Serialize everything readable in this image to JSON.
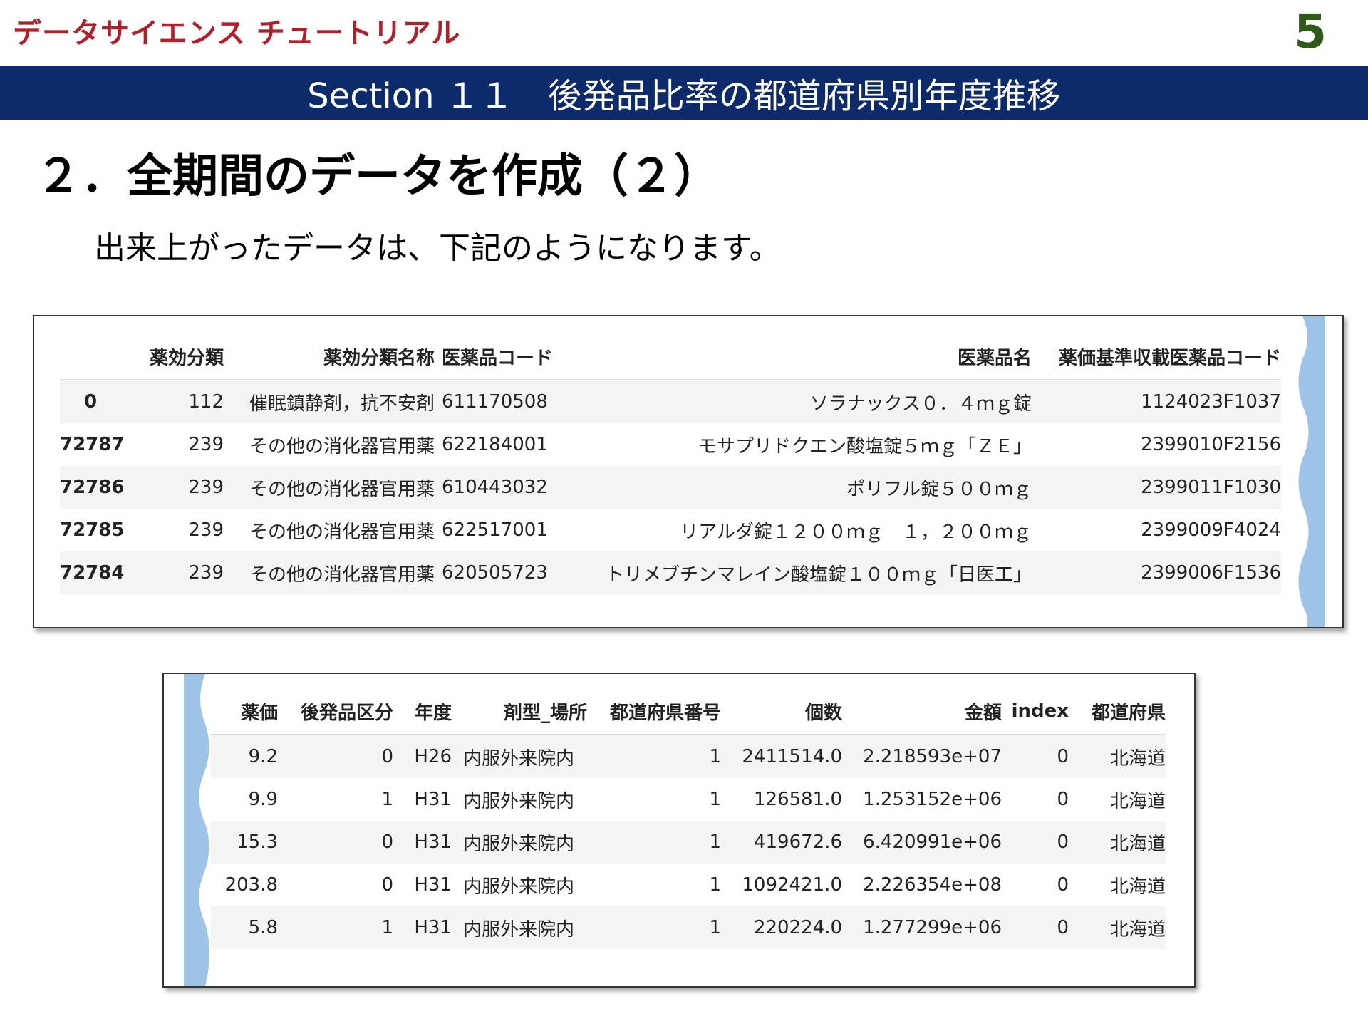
{
  "header": {
    "brand": "データサイエンス チュートリアル",
    "page_number": "5",
    "section_title": "Section １１　後発品比率の都道府県別年度推移"
  },
  "main": {
    "heading": "２．全期間のデータを作成（２）",
    "description": "出来上がったデータは、下記のようになります。"
  },
  "table1": {
    "columns": [
      "",
      "薬効分類",
      "薬効分類名称",
      "医薬品コード",
      "医薬品名",
      "薬価基準収載医薬品コード"
    ],
    "rows": [
      [
        "0",
        "112",
        "催眠鎮静剤，抗不安剤",
        "611170508",
        "ソラナックス０．４ｍｇ錠",
        "1124023F1037"
      ],
      [
        "72787",
        "239",
        "その他の消化器官用薬",
        "622184001",
        "モサプリドクエン酸塩錠５ｍｇ「ＺＥ」",
        "2399010F2156"
      ],
      [
        "72786",
        "239",
        "その他の消化器官用薬",
        "610443032",
        "ポリフル錠５００ｍｇ",
        "2399011F1030"
      ],
      [
        "72785",
        "239",
        "その他の消化器官用薬",
        "622517001",
        "リアルダ錠１２００ｍｇ　１，２００ｍｇ",
        "2399009F4024"
      ],
      [
        "72784",
        "239",
        "その他の消化器官用薬",
        "620505723",
        "トリメブチンマレイン酸塩錠１００ｍｇ「日医工」",
        "2399006F1536"
      ]
    ]
  },
  "table2": {
    "columns": [
      "薬価",
      "後発品区分",
      "年度",
      "剤型_場所",
      "都道府県番号",
      "個数",
      "金額",
      "index",
      "都道府県"
    ],
    "rows": [
      [
        "9.2",
        "0",
        "H26",
        "内服外来院内",
        "1",
        "2411514.0",
        "2.218593e+07",
        "0",
        "北海道"
      ],
      [
        "9.9",
        "1",
        "H31",
        "内服外来院内",
        "1",
        "126581.0",
        "1.253152e+06",
        "0",
        "北海道"
      ],
      [
        "15.3",
        "0",
        "H31",
        "内服外来院内",
        "1",
        "419672.6",
        "6.420991e+06",
        "0",
        "北海道"
      ],
      [
        "203.8",
        "0",
        "H31",
        "内服外来院内",
        "1",
        "1092421.0",
        "2.226354e+08",
        "0",
        "北海道"
      ],
      [
        "5.8",
        "1",
        "H31",
        "内服外来院内",
        "1",
        "220224.0",
        "1.277299e+06",
        "0",
        "北海道"
      ]
    ]
  },
  "colors": {
    "brand": "#b0202a",
    "page_number": "#2f5a1c",
    "section_bar": "#0d2a6b",
    "tear_edge": "#9dc3e6"
  }
}
